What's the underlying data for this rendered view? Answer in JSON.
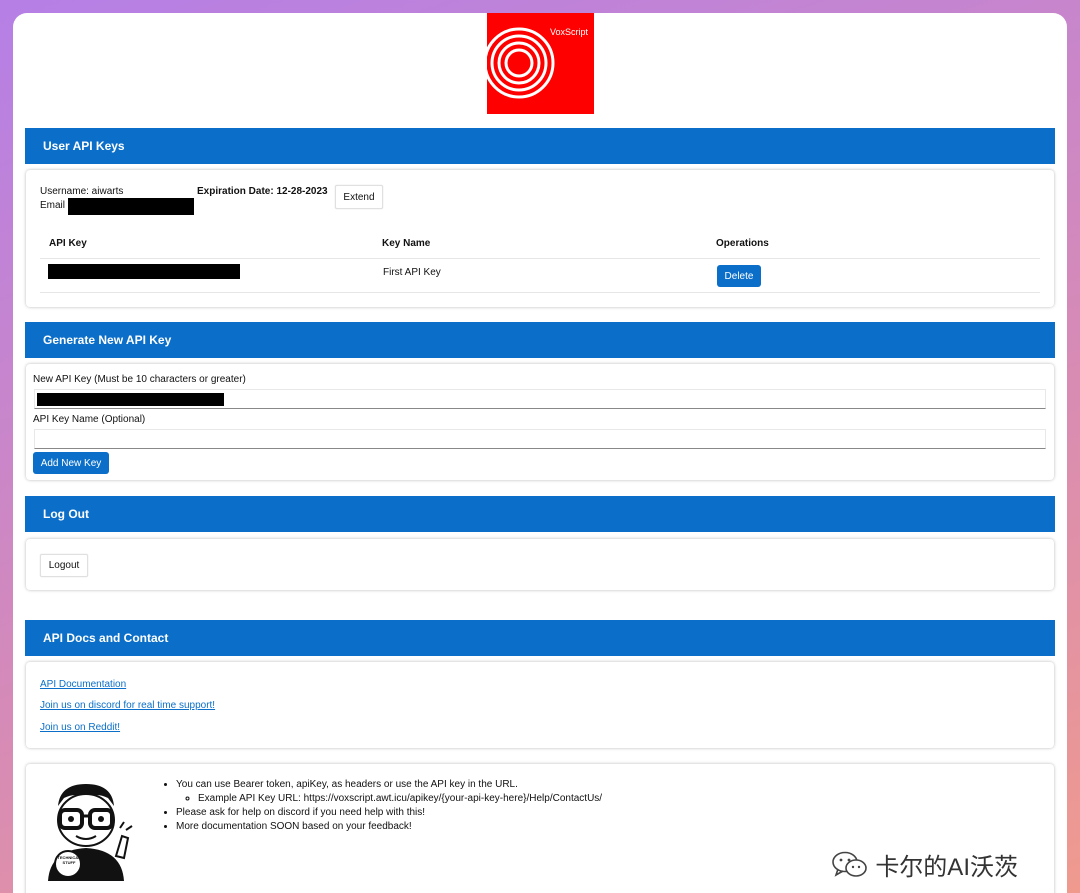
{
  "logo": {
    "text": "VoxScript"
  },
  "user_keys": {
    "header": "User API Keys",
    "username": "Username: aiwarts",
    "email_label": "Email",
    "expiration": "Expiration Date: 12-28-2023",
    "extend_label": "Extend",
    "columns": [
      "API Key",
      "Key Name",
      "Operations"
    ],
    "rows": [
      {
        "key_name": "First API Key",
        "delete_label": "Delete"
      }
    ]
  },
  "generate": {
    "header": "Generate New API Key",
    "key_label": "New API Key (Must be 10 characters or greater)",
    "name_label": "API Key Name (Optional)",
    "add_label": "Add New Key"
  },
  "logout": {
    "header": "Log Out",
    "button_label": "Logout"
  },
  "docs": {
    "header": "API Docs and Contact",
    "links": [
      "API Documentation",
      "Join us on discord for real time support!",
      "Join us on Reddit!"
    ]
  },
  "info": {
    "bullet1": "You can use Bearer token, apiKey, as headers or use the API key in the URL.",
    "sub_bullet": "Example API Key URL: https://voxscript.awt.icu/apikey/{your-api-key-here}/Help/ContactUs/",
    "bullet2": "Please ask for help on discord if you need help with this!",
    "bullet3": "More documentation SOON based on your feedback!",
    "badge_line1": "TECHNICAL",
    "badge_line2": "STUFF"
  },
  "watermark": {
    "text": "卡尔的AI沃茨"
  },
  "colors": {
    "accent": "#0b6fc9",
    "logo_red": "#ff0000"
  }
}
